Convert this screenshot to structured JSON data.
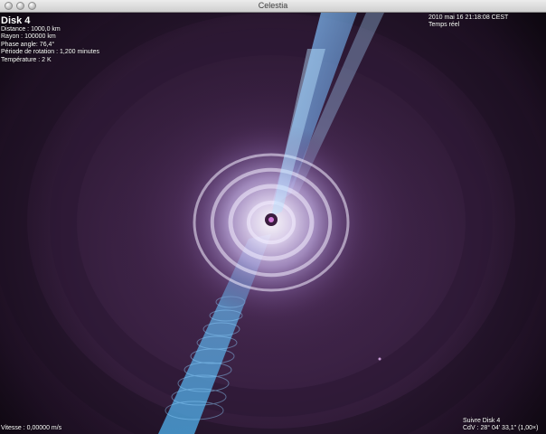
{
  "window": {
    "title": "Celestia"
  },
  "info": {
    "object_name": "Disk 4",
    "distance": "Distance : 1000,0 km",
    "radius": "Rayon : 100000 km",
    "phase_angle": "Phase angle: 76,4°",
    "rotation_period": "Période de rotation : 1,200 minutes",
    "temperature": "Température : 2 K"
  },
  "time": {
    "datetime": "2010 mai 16 21:18:08 CEST",
    "mode": "Temps réel"
  },
  "status": {
    "speed": "Vitesse : 0,00000 m/s",
    "follow": "Suivre Disk 4",
    "fov": "CdV : 28° 04' 33,1\" (1,00×)"
  }
}
